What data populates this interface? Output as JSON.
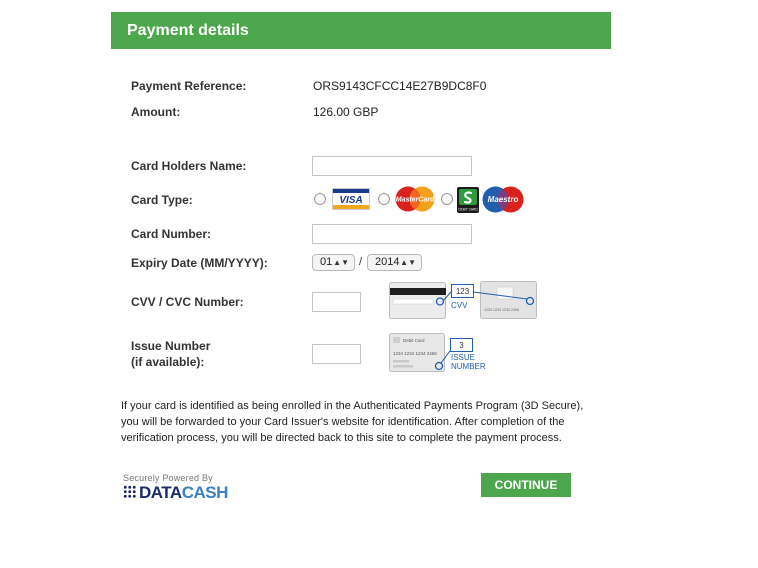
{
  "header": {
    "title": "Payment details"
  },
  "reference": {
    "label": "Payment Reference:",
    "value": "ORS9143CFCC14E27B9DC8F0"
  },
  "amount": {
    "label": "Amount:",
    "value": "126.00 GBP"
  },
  "card_holder": {
    "label": "Card Holders Name:",
    "value": ""
  },
  "card_type": {
    "label": "Card Type:",
    "options": [
      {
        "name": "VISA"
      },
      {
        "name": "MasterCard"
      },
      {
        "name": "Solo"
      },
      {
        "name": "Maestro"
      }
    ],
    "solo_caption": "DEBIT CARD"
  },
  "card_number": {
    "label": "Card Number:",
    "value": ""
  },
  "expiry": {
    "label": "Expiry Date (MM/YYYY):",
    "month": "01",
    "year": "2014",
    "separator": "/"
  },
  "cvv": {
    "label": "CVV / CVC Number:",
    "value": "",
    "example_code": "123",
    "example_caption": "CVV",
    "card_number_sample": "1234 1234 1234 2456"
  },
  "issue": {
    "label_line1": "Issue Number",
    "label_line2": "(if available):",
    "value": "",
    "example_code": "3",
    "example_caption_1": "ISSUE",
    "example_caption_2": "NUMBER",
    "card_title": "Debit Card",
    "card_number_sample": "1234 1234 1234 2456"
  },
  "info_text": "If your card is identified as being enrolled in the Authenticated Payments Program (3D Secure), you will be forwarded to your Card Issuer's website for identification. After completion of the verification process, you will be directed back to this site to complete the payment process.",
  "powered_by": {
    "caption": "Securely Powered By",
    "brand_data": "DATA",
    "brand_cash": "CASH"
  },
  "continue_label": "CONTINUE",
  "colors": {
    "accent": "#4ca64c",
    "brand_navy": "#1b2a6b",
    "brand_blue": "#3b7fc4"
  }
}
